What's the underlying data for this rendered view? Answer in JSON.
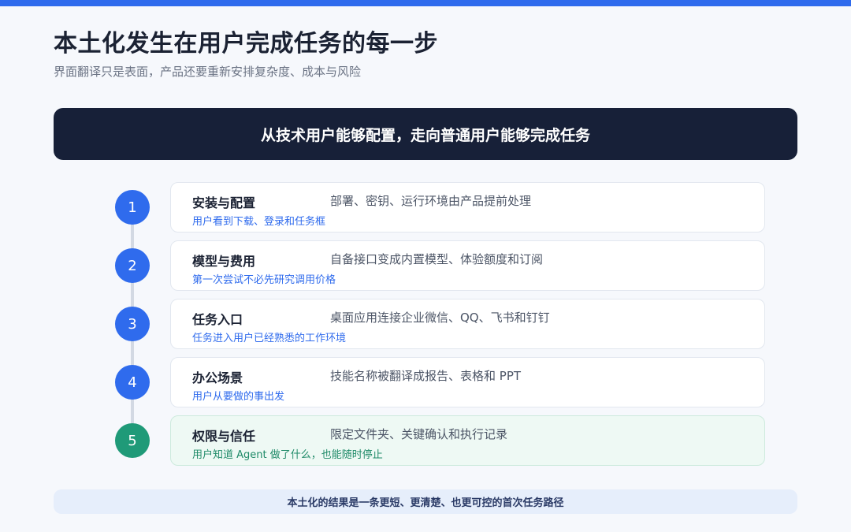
{
  "title": "本土化发生在用户完成任务的每一步",
  "subtitle": "界面翻译只是表面，产品还要重新安排复杂度、成本与风险",
  "banner": "从技术用户能够配置，走向普通用户能够完成任务",
  "steps": [
    {
      "number": "1",
      "title": "安装与配置",
      "desc": "部署、密钥、运行环境由产品提前处理",
      "sub": "用户看到下载、登录和任务框"
    },
    {
      "number": "2",
      "title": "模型与费用",
      "desc": "自备接口变成内置模型、体验额度和订阅",
      "sub": "第一次尝试不必先研究调用价格"
    },
    {
      "number": "3",
      "title": "任务入口",
      "desc": "桌面应用连接企业微信、QQ、飞书和钉钉",
      "sub": "任务进入用户已经熟悉的工作环境"
    },
    {
      "number": "4",
      "title": "办公场景",
      "desc": "技能名称被翻译成报告、表格和 PPT",
      "sub": "用户从要做的事出发"
    },
    {
      "number": "5",
      "title": "权限与信任",
      "desc": "限定文件夹、关键确认和执行记录",
      "sub": "用户知道 Agent 做了什么，也能随时停止"
    }
  ],
  "footer": "本土化的结果是一条更短、更清楚、也更可控的首次任务路径",
  "colors": {
    "accent": "#2f6bed",
    "dark": "#172038",
    "success": "#1f9a78"
  }
}
